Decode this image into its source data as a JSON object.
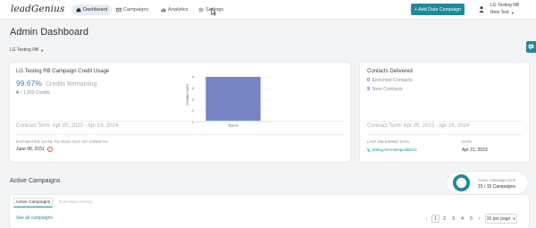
{
  "nav": {
    "logo_text": "leadGenius",
    "items": [
      {
        "label": "Dashboard",
        "icon": "home-icon",
        "active": true
      },
      {
        "label": "Campaigns",
        "icon": "envelope-icon",
        "active": false
      },
      {
        "label": "Analytics",
        "icon": "bar-chart-icon",
        "active": false
      },
      {
        "label": "Settings",
        "icon": "gear-icon",
        "active": false
      }
    ],
    "add_button": "+ Add Data Campaign",
    "user": {
      "name": "LG Testing RB",
      "org": "Rein Test"
    }
  },
  "page": {
    "title": "Admin Dashboard",
    "campaign_select": "LG Testing RB"
  },
  "credit_card": {
    "title": "LG Testing RB Campaign Credit Usage",
    "percent": "99.67%",
    "percent_label": "Credits Remaining",
    "used": "4",
    "total": "/ 1,200 Credits",
    "contract": "Contract Term: Apr 20, 2023 - Apr 19, 2024",
    "estimate_label": "ESTIMATED DATE TO RUN OUT OF CREDITS",
    "estimate_value": "June 08, 2151"
  },
  "chart_data": {
    "type": "bar",
    "categories": [
      "Teams"
    ],
    "values": [
      4
    ],
    "ylabel": "Credits Used",
    "ylim": [
      0,
      4
    ],
    "yticks": [
      0,
      1,
      2,
      3,
      4
    ],
    "color": "#7784c4"
  },
  "contacts_card": {
    "title": "Contacts Delivered",
    "enriched_count": "0",
    "enriched_label": "Enriched Contacts",
    "new_count": "9",
    "new_label": "New Contacts",
    "contract": "Contract Term: Apr 20, 2023 - Apr 19, 2024",
    "last_label": "LAST DELIVERED DATA",
    "last_link": "lg_testing+9+crotonpod56213",
    "date_label": "DATE",
    "date_value": "Apr 21, 2023"
  },
  "campaigns": {
    "title": "Active Campaigns",
    "limit_label": "Active Campaign Limit",
    "limit_value": "15 / 15 Campaigns",
    "usage_fraction": 1.0,
    "tabs": [
      "Active Campaigns",
      "Extension History"
    ],
    "see_all": "See all campaigns",
    "pages": [
      "1",
      "2",
      "3",
      "4",
      "5"
    ],
    "current_page": "1",
    "per_page": "10 per page"
  },
  "colors": {
    "accent": "#1f8a99",
    "bar": "#7784c4"
  }
}
